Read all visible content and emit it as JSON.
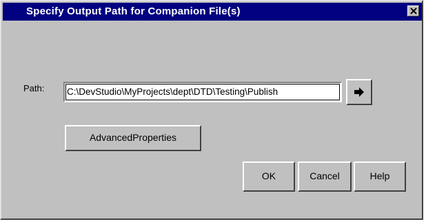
{
  "window": {
    "title": "Specify Output Path for Companion File(s)",
    "close_icon": "close-icon"
  },
  "path": {
    "label": "Path:",
    "value": "C:\\DevStudio\\MyProjects\\dept\\DTD\\Testing\\Publish",
    "browse_icon": "arrow-right-icon"
  },
  "buttons": {
    "advanced": "AdvancedProperties",
    "ok": "OK",
    "cancel": "Cancel",
    "help": "Help"
  },
  "colors": {
    "titlebar": "#000080",
    "face": "#c0c0c0",
    "title_text": "#ffffff"
  }
}
